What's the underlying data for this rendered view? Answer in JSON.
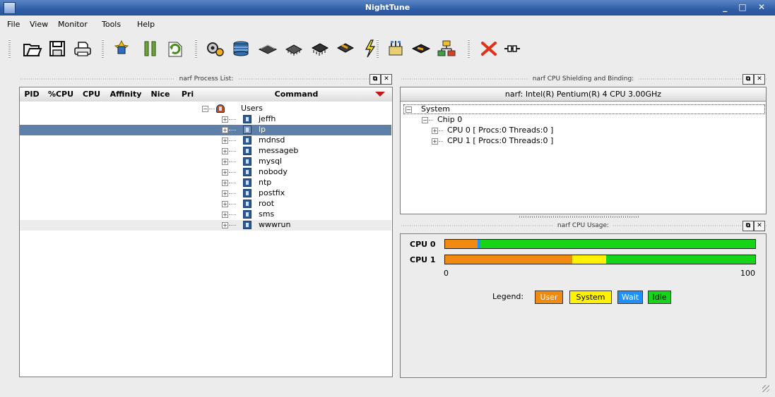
{
  "window": {
    "title": "NightTune",
    "controls": "_ □ ✕"
  },
  "menu": [
    "File",
    "View",
    "Monitor",
    "Tools",
    "Help"
  ],
  "toolbar": {
    "buttons": [
      {
        "name": "open-icon"
      },
      {
        "name": "save-icon"
      },
      {
        "name": "print-icon"
      },
      {
        "name": "refresh-icon"
      },
      {
        "name": "pause-icon"
      },
      {
        "name": "restart-icon"
      },
      {
        "name": "process-icon"
      },
      {
        "name": "memory-icon"
      },
      {
        "name": "disk-icon"
      },
      {
        "name": "chip-icon"
      },
      {
        "name": "cpu-icon"
      },
      {
        "name": "interrupt-icon"
      },
      {
        "name": "network-icon"
      },
      {
        "name": "device-icon"
      },
      {
        "name": "nodes-icon"
      },
      {
        "name": "close-icon"
      },
      {
        "name": "connect-icon"
      }
    ]
  },
  "process_panel": {
    "title": "narf Process List:",
    "columns": [
      "PID",
      "%CPU",
      "CPU",
      "Affinity",
      "Nice",
      "Pri",
      "Command"
    ],
    "root_label": "Users",
    "users": [
      "jeffh",
      "lp",
      "mdnsd",
      "messageb",
      "mysql",
      "nobody",
      "ntp",
      "postfix",
      "root",
      "sms",
      "wwwrun"
    ],
    "selected_user": "lp"
  },
  "shield_panel": {
    "title": "narf CPU Shielding and Binding:",
    "header": "narf:  Intel(R) Pentium(R) 4 CPU 3.00GHz",
    "tree": {
      "system": "System",
      "chip": "Chip 0",
      "cpus": [
        "CPU 0  [ Procs:0 Threads:0 ]",
        "CPU 1  [ Procs:0 Threads:0 ]"
      ]
    }
  },
  "usage_panel": {
    "title": "narf CPU Usage:",
    "cpus": [
      {
        "label": "CPU 0",
        "user": 10.5,
        "system": 0,
        "wait": 1,
        "idle": 88.5
      },
      {
        "label": "CPU 1",
        "user": 41,
        "system": 11,
        "wait": 0,
        "idle": 48
      }
    ],
    "axis_min": "0",
    "axis_max": "100",
    "legend_label": "Legend:",
    "legend": [
      {
        "label": "User",
        "color": "#f08a10"
      },
      {
        "label": "System",
        "color": "#fff200"
      },
      {
        "label": "Wait",
        "color": "#1e90ff"
      },
      {
        "label": "Idle",
        "color": "#18d418"
      }
    ]
  }
}
